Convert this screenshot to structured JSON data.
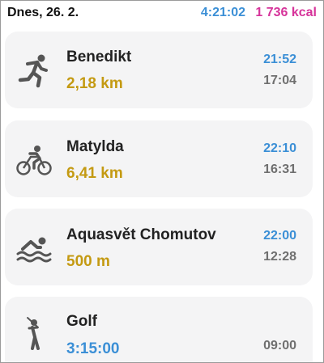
{
  "header": {
    "date": "Dnes, 26. 2.",
    "total_duration": "4:21:02",
    "total_kcal": "1 736 kcal",
    "colors": {
      "duration": "#3b8fd6",
      "kcal": "#d6339a"
    }
  },
  "activities": [
    {
      "icon": "running-icon",
      "name": "Benedikt",
      "value": "2,18 km",
      "end_time": "21:52",
      "start_time": "17:04"
    },
    {
      "icon": "cycling-icon",
      "name": "Matylda",
      "value": "6,41 km",
      "end_time": "22:10",
      "start_time": "16:31"
    },
    {
      "icon": "swimming-icon",
      "name": "Aquasvět Chomutov",
      "value": "500 m",
      "end_time": "22:00",
      "start_time": "12:28"
    },
    {
      "icon": "golf-icon",
      "name": "Golf",
      "value": "3:15:00",
      "end_time": "",
      "start_time": "09:00"
    }
  ],
  "colors": {
    "distance": "#c49a12",
    "time_blue": "#3b8fd6",
    "muted": "#6f6f6f"
  }
}
